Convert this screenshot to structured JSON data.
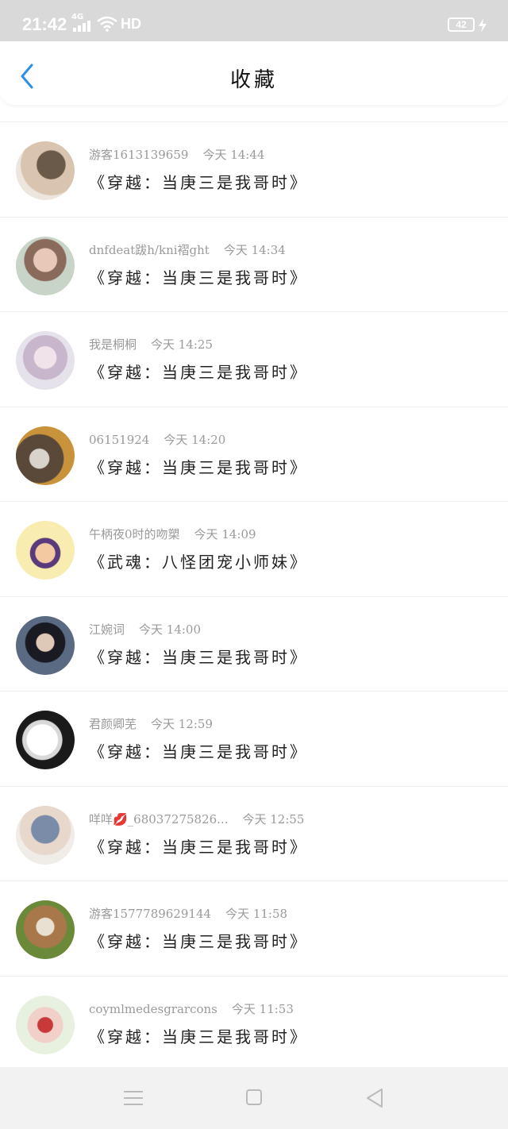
{
  "status": {
    "time": "21:42",
    "network": "4G",
    "hd": "HD",
    "battery": "42"
  },
  "header": {
    "title": "收藏"
  },
  "items": [
    {
      "user": "游客1613139659",
      "time": "今天 14:44",
      "title": "《穿越：当庚三是我哥时》",
      "avatar_color": "#c9b9a8"
    },
    {
      "user": "dnfdeat跋h/kni褶ght",
      "time": "今天 14:34",
      "title": "《穿越：当庚三是我哥时》",
      "avatar_color": "#d8c7b6"
    },
    {
      "user": "我是桐桐",
      "time": "今天 14:25",
      "title": "《穿越：当庚三是我哥时》",
      "avatar_color": "#cfc6d6"
    },
    {
      "user": "06151924",
      "time": "今天 14:20",
      "title": "《穿越：当庚三是我哥时》",
      "avatar_color": "#6b5844"
    },
    {
      "user": "午柄夜0时的吻槊",
      "time": "今天 14:09",
      "title": "《武魂：八怪团宠小师妹》",
      "avatar_color": "#f6e9a8"
    },
    {
      "user": "江婉词",
      "time": "今天 14:00",
      "title": "《穿越：当庚三是我哥时》",
      "avatar_color": "#3d4a5c"
    },
    {
      "user": "君颜卿芜",
      "time": "今天 12:59",
      "title": "《穿越：当庚三是我哥时》",
      "avatar_color": "#2a2a2a"
    },
    {
      "user": "咩咩💋_68037275826...",
      "time": "今天 12:55",
      "title": "《穿越：当庚三是我哥时》",
      "avatar_color": "#a9b4c4"
    },
    {
      "user": "游客1577789629144",
      "time": "今天 11:58",
      "title": "《穿越：当庚三是我哥时》",
      "avatar_color": "#7a6a3c"
    },
    {
      "user": "coymlmedesgrarcons",
      "time": "今天 11:53",
      "title": "《穿越：当庚三是我哥时》",
      "avatar_color": "#e3b9b0"
    }
  ],
  "colors": {
    "accent": "#2a8fe8",
    "meta_text": "#9a9a9a"
  }
}
